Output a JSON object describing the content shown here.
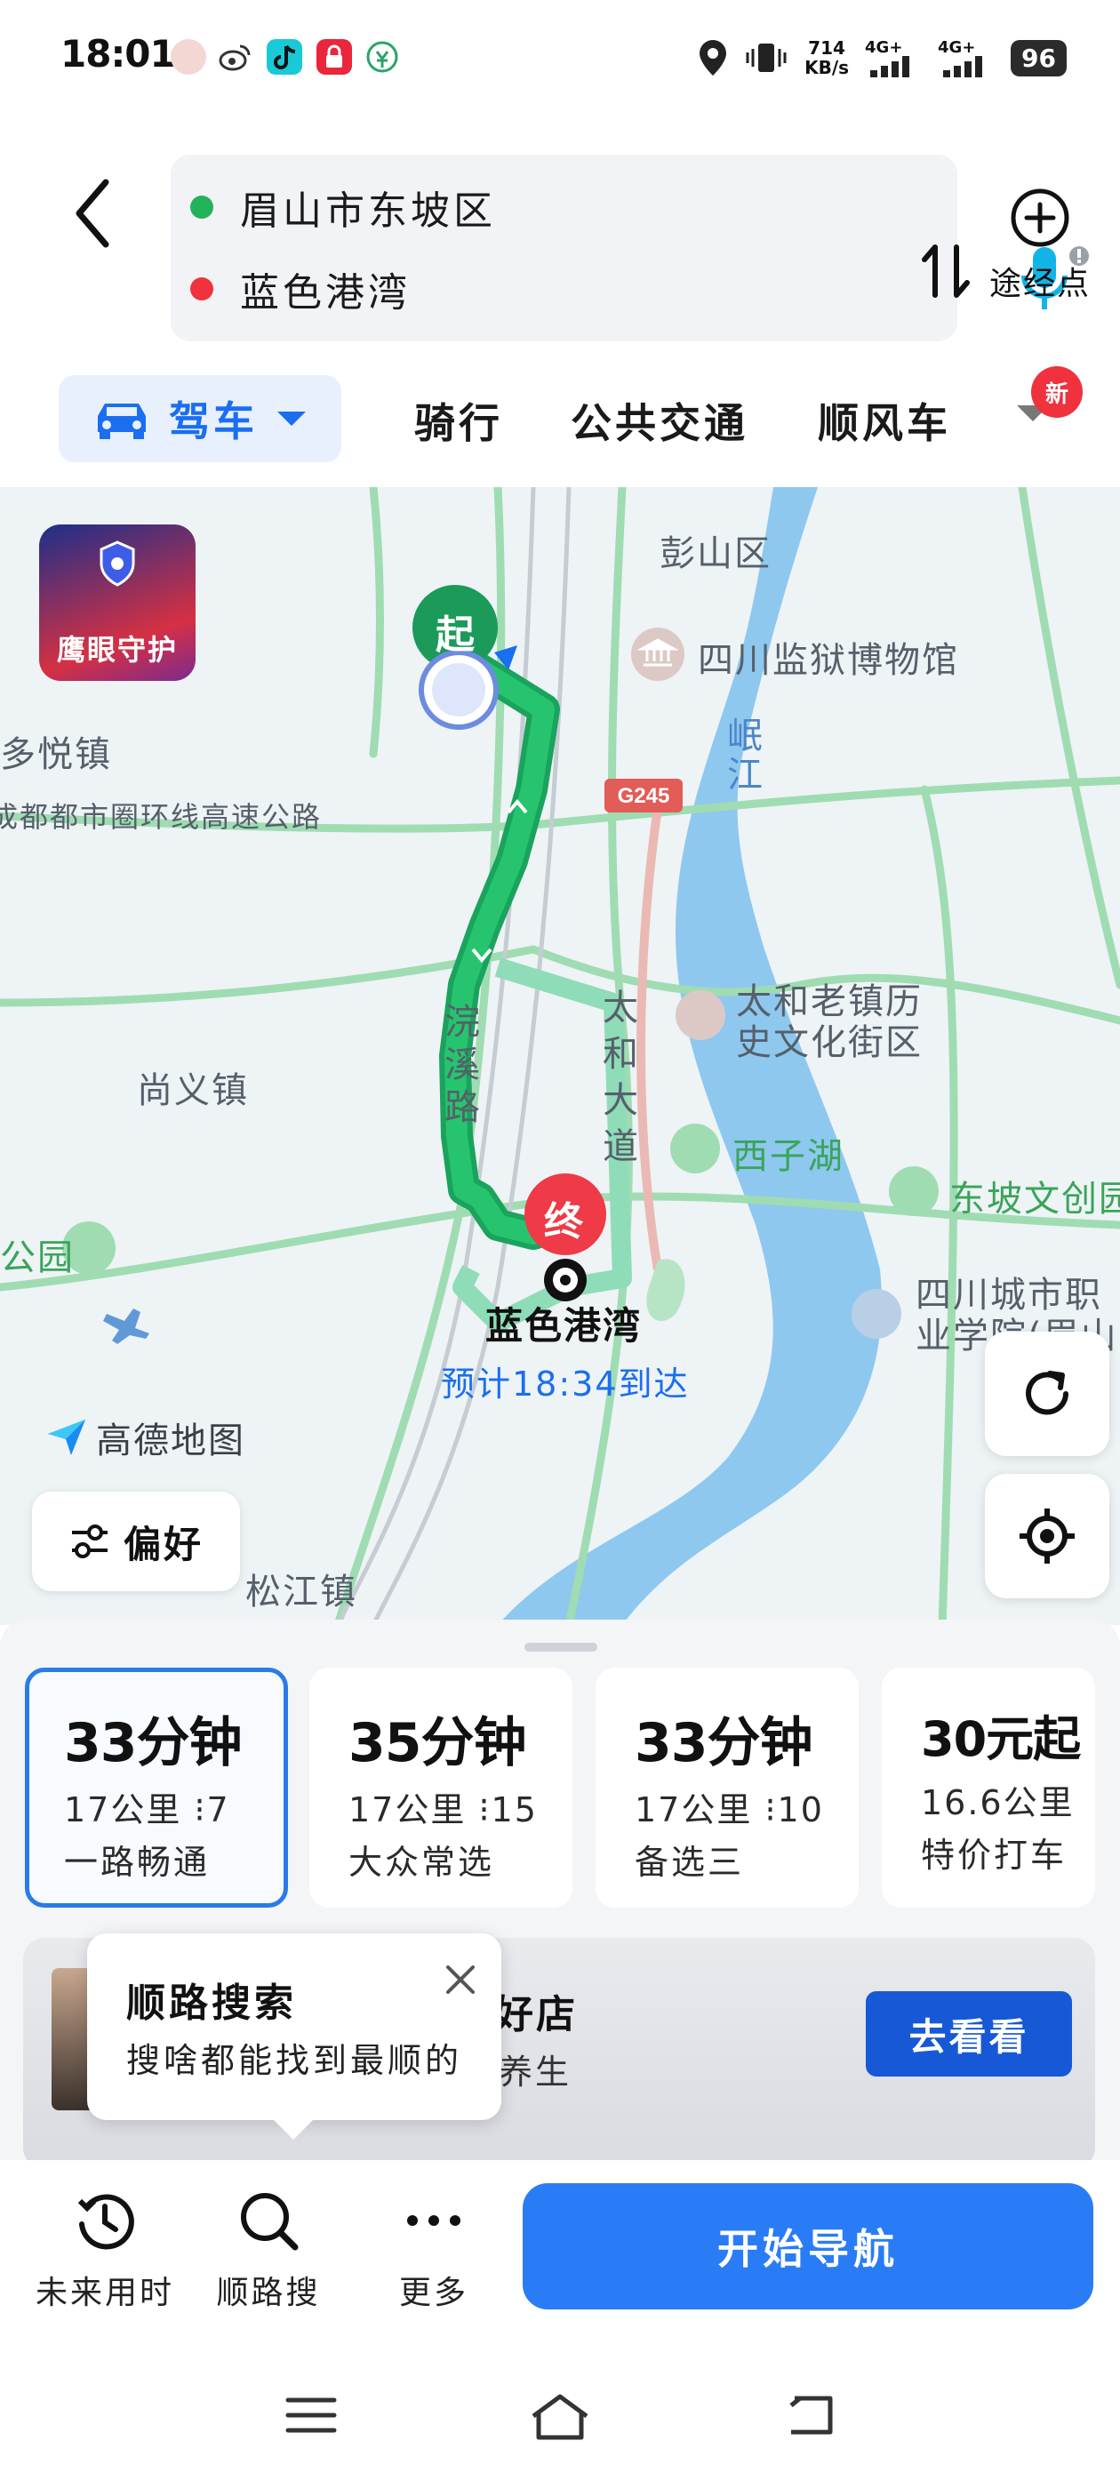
{
  "status_bar": {
    "time": "18:01",
    "network_speed_value": "714",
    "network_speed_unit": "KB/s",
    "signal_1": "4G+",
    "signal_2": "4G+",
    "battery": "96"
  },
  "route": {
    "origin": "眉山市东坡区",
    "destination": "蓝色港湾",
    "via_label": "途经点",
    "origin_color": "#22b35a",
    "destination_color": "#f0313e"
  },
  "modes": {
    "drive": "驾车",
    "ride": "骑行",
    "transit": "公共交通",
    "carpool": "顺风车",
    "new_badge": "新"
  },
  "map": {
    "eagle_eye": "鹰眼守护",
    "start_marker": "起",
    "end_marker": "终",
    "labels": {
      "pengshan": "彭山区",
      "prison_museum": "四川监狱博物馆",
      "river": "岷江",
      "duoyue": "多悦镇",
      "ring_road": "成都都市圈环线高速公路",
      "g245": "G245",
      "taihe_town": "太和老镇历史文化街区",
      "shangyi": "尚义镇",
      "huanxi_road": "浣溪路",
      "taihe_ave": "太和大道",
      "xizi_lake": "西子湖",
      "dongpo_park": "东坡文创园",
      "sichuan_college": "四川城市职业学院(眉山校区)",
      "park": "公园",
      "songjiang": "松江镇",
      "destination": "蓝色港湾",
      "eta": "预计18:34到达"
    },
    "logo": "高德地图",
    "preference": "偏好"
  },
  "routes": [
    {
      "time": "33分钟",
      "distance": "17公里",
      "lights": "7",
      "tag": "一路畅通"
    },
    {
      "time": "35分钟",
      "distance": "17公里",
      "lights": "15",
      "tag": "大众常选"
    },
    {
      "time": "33分钟",
      "distance": "17公里",
      "lights": "10",
      "tag": "备选三"
    },
    {
      "time": "30元起",
      "distance": "16.6公里",
      "lights": "",
      "tag": "特价打车"
    }
  ],
  "promo": {
    "title_fragment": "好店",
    "subtitle_fragment": "养生",
    "button": "去看看"
  },
  "tooltip": {
    "title": "顺路搜索",
    "subtitle": "搜啥都能找到最顺的"
  },
  "actions": {
    "future_time": "未来用时",
    "along_search": "顺路搜",
    "more": "更多",
    "start_nav": "开始导航"
  }
}
